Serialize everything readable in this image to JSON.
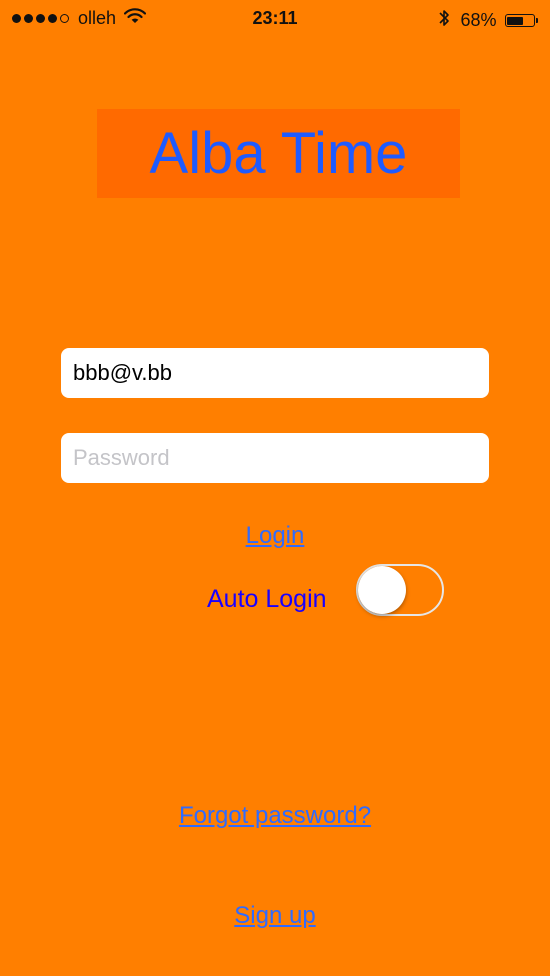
{
  "status_bar": {
    "carrier": "olleh",
    "time": "23:11",
    "battery_percent": "68%",
    "battery_level": 0.68,
    "signal_bars_filled": 4,
    "signal_bars_total": 5
  },
  "app": {
    "title": "Alba Time",
    "title_color": "#1E5BFF",
    "background_color": "#FF7F00"
  },
  "form": {
    "email_value": "bbb@v.bb",
    "password_value": "",
    "password_placeholder": "Password",
    "login_label": "Login",
    "auto_login_label": "Auto Login",
    "auto_login_enabled": false,
    "forgot_password_label": "Forgot password?",
    "sign_up_label": "Sign up"
  }
}
